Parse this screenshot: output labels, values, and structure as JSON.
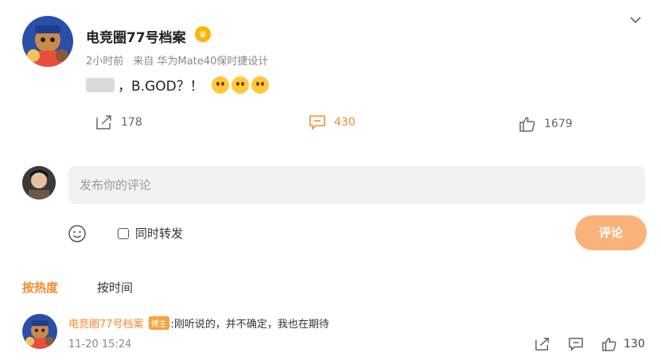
{
  "post": {
    "author": "电竞圈77号档案",
    "time_ago": "2小时前",
    "source": "来自 华为Mate40保时捷设计",
    "text": "，B.GOD？！",
    "actions": {
      "share_count": "178",
      "comment_count": "430",
      "like_count": "1679"
    },
    "colors": {
      "accent": "#f7892b"
    }
  },
  "composer": {
    "placeholder": "发布你的评论",
    "repost_label": "同时转发",
    "submit_label": "评论"
  },
  "sort": {
    "hot": "按热度",
    "time": "按时间"
  },
  "comment": {
    "author": "电竞圈77号档案",
    "tag": "博主",
    "text": ":刚听说的，并不确定，我也在期待",
    "time": "11-20 15:24",
    "like_count": "130"
  }
}
